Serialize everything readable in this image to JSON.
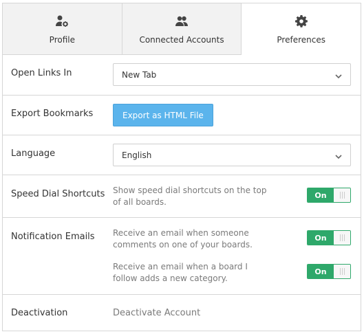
{
  "tabs": [
    {
      "label": "Profile",
      "icon": "user-gear-icon",
      "active": false
    },
    {
      "label": "Connected Accounts",
      "icon": "users-icon",
      "active": false
    },
    {
      "label": "Preferences",
      "icon": "gear-icon",
      "active": true
    }
  ],
  "open_links": {
    "label": "Open Links In",
    "value": "New Tab"
  },
  "export": {
    "label": "Export Bookmarks",
    "button": "Export as HTML File"
  },
  "language": {
    "label": "Language",
    "value": "English"
  },
  "speed_dial": {
    "label": "Speed Dial Shortcuts",
    "description": "Show speed dial shortcuts on the top of all boards.",
    "toggle": "On"
  },
  "notifications": {
    "label": "Notification Emails",
    "items": [
      {
        "description": "Receive an email when someone comments on one of your boards.",
        "toggle": "On"
      },
      {
        "description": "Receive an email when a board I follow adds a new category.",
        "toggle": "On"
      }
    ]
  },
  "deactivation": {
    "label": "Deactivation",
    "link": "Deactivate Account"
  },
  "colors": {
    "accent_blue": "#5bb4ec",
    "toggle_green": "#2ea86a"
  }
}
